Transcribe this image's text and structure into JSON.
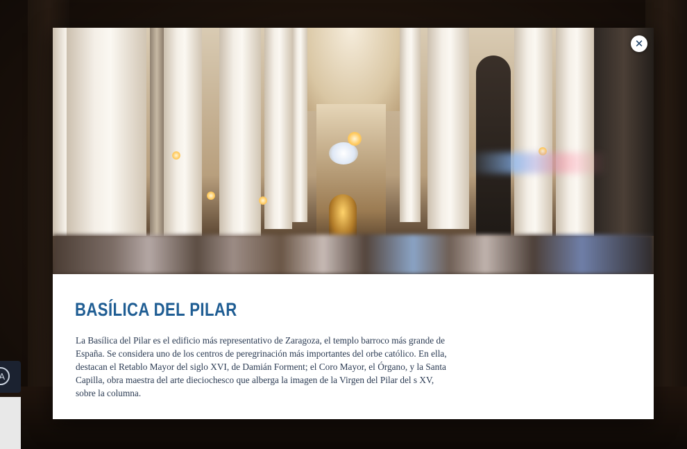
{
  "modal": {
    "image_alt": "Basílica del Pilar interior",
    "close_icon": "close-icon",
    "title": "BASÍLICA DEL PILAR",
    "description": "La Basílica del Pilar es el edificio más representativo de Zaragoza, el templo barroco más grande de España. Se considera uno de los centros de peregrinación más importantes del orbe católico. En ella, destacan el Retablo Mayor del siglo XVI, de Damián Forment; el Coro Mayor, el Órgano, y la Santa Capilla, obra maestra del arte dieciochesco que alberga la imagen de la Virgen del Pilar del s XV, sobre la columna.",
    "colors": {
      "title": "#1f5d93",
      "text": "#2a3a52",
      "close_x": "#1b3f66"
    }
  },
  "side_nav": {
    "icon": "circle-letter-icon",
    "label": "A"
  }
}
